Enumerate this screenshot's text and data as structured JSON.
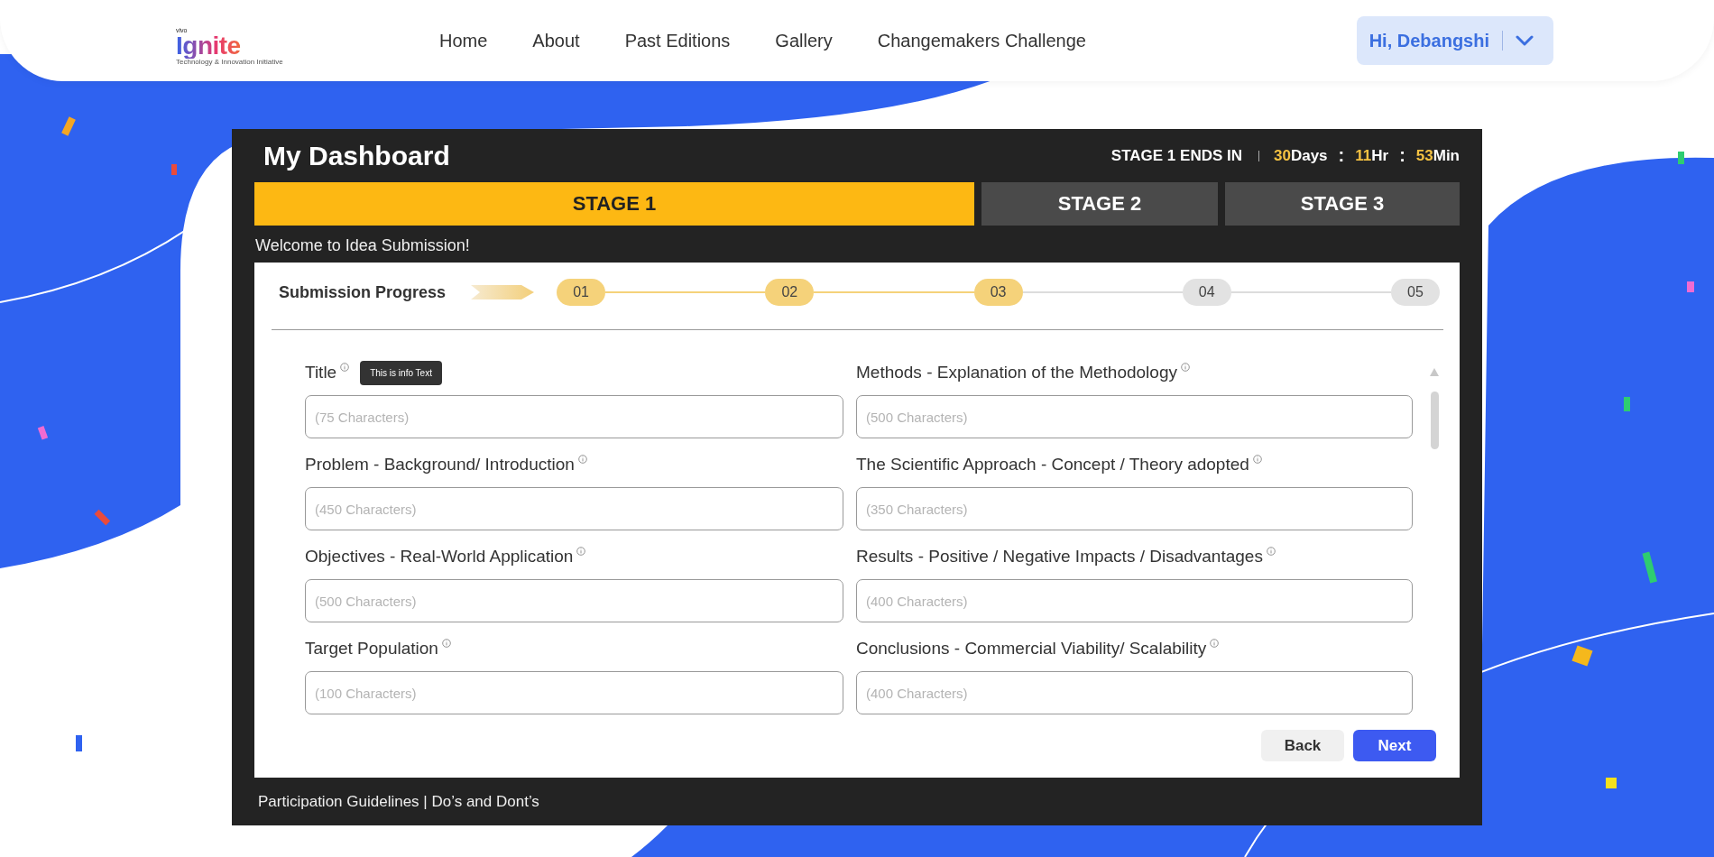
{
  "header": {
    "logo": {
      "brand": "vivo",
      "name": "Ignite",
      "tagline": "Technology & Innovation Initiative"
    },
    "nav": [
      "Home",
      "About",
      "Past Editions",
      "Gallery",
      "Changemakers Challenge"
    ],
    "user_menu": {
      "label": "Hi, Debangshi"
    }
  },
  "dashboard": {
    "title": "My Dashboard",
    "countdown": {
      "label": "STAGE 1 ENDS IN",
      "separator": ":",
      "parts": [
        {
          "value": "30",
          "unit": "Days"
        },
        {
          "value": "11",
          "unit": "Hr"
        },
        {
          "value": "53",
          "unit": "Min"
        }
      ]
    },
    "tabs": [
      {
        "label": "STAGE 1",
        "selected": true
      },
      {
        "label": "STAGE 2",
        "selected": false
      },
      {
        "label": "STAGE 3",
        "selected": false
      }
    ],
    "welcome": "Welcome to Idea Submission!",
    "progress": {
      "label": "Submission Progress",
      "steps": [
        {
          "label": "01",
          "done": true
        },
        {
          "label": "02",
          "done": true
        },
        {
          "label": "03",
          "done": true
        },
        {
          "label": "04",
          "done": false
        },
        {
          "label": "05",
          "done": false
        }
      ]
    },
    "fields": [
      {
        "label": "Title",
        "placeholder": "(75 Characters)",
        "tooltip": "This is info Text"
      },
      {
        "label": "Methods - Explanation of the Methodology",
        "placeholder": "(500 Characters)"
      },
      {
        "label": "Problem - Background/ Introduction",
        "placeholder": "(450 Characters)"
      },
      {
        "label": "The Scientific Approach  - Concept / Theory adopted",
        "placeholder": "(350 Characters)"
      },
      {
        "label": "Objectives - Real-World Application",
        "placeholder": "(500 Characters)"
      },
      {
        "label": "Results - Positive / Negative Impacts / Disadvantages",
        "placeholder": "(400 Characters)"
      },
      {
        "label": "Target Population",
        "placeholder": "(100 Characters)"
      },
      {
        "label": "Conclusions - Commercial Viability/ Scalability",
        "placeholder": "(400 Characters)"
      }
    ],
    "buttons": [
      {
        "label": "Back",
        "kind": "secondary"
      },
      {
        "label": "Next",
        "kind": "primary"
      }
    ],
    "footer": "Participation Guidelines | Do’s and Dont’s"
  }
}
